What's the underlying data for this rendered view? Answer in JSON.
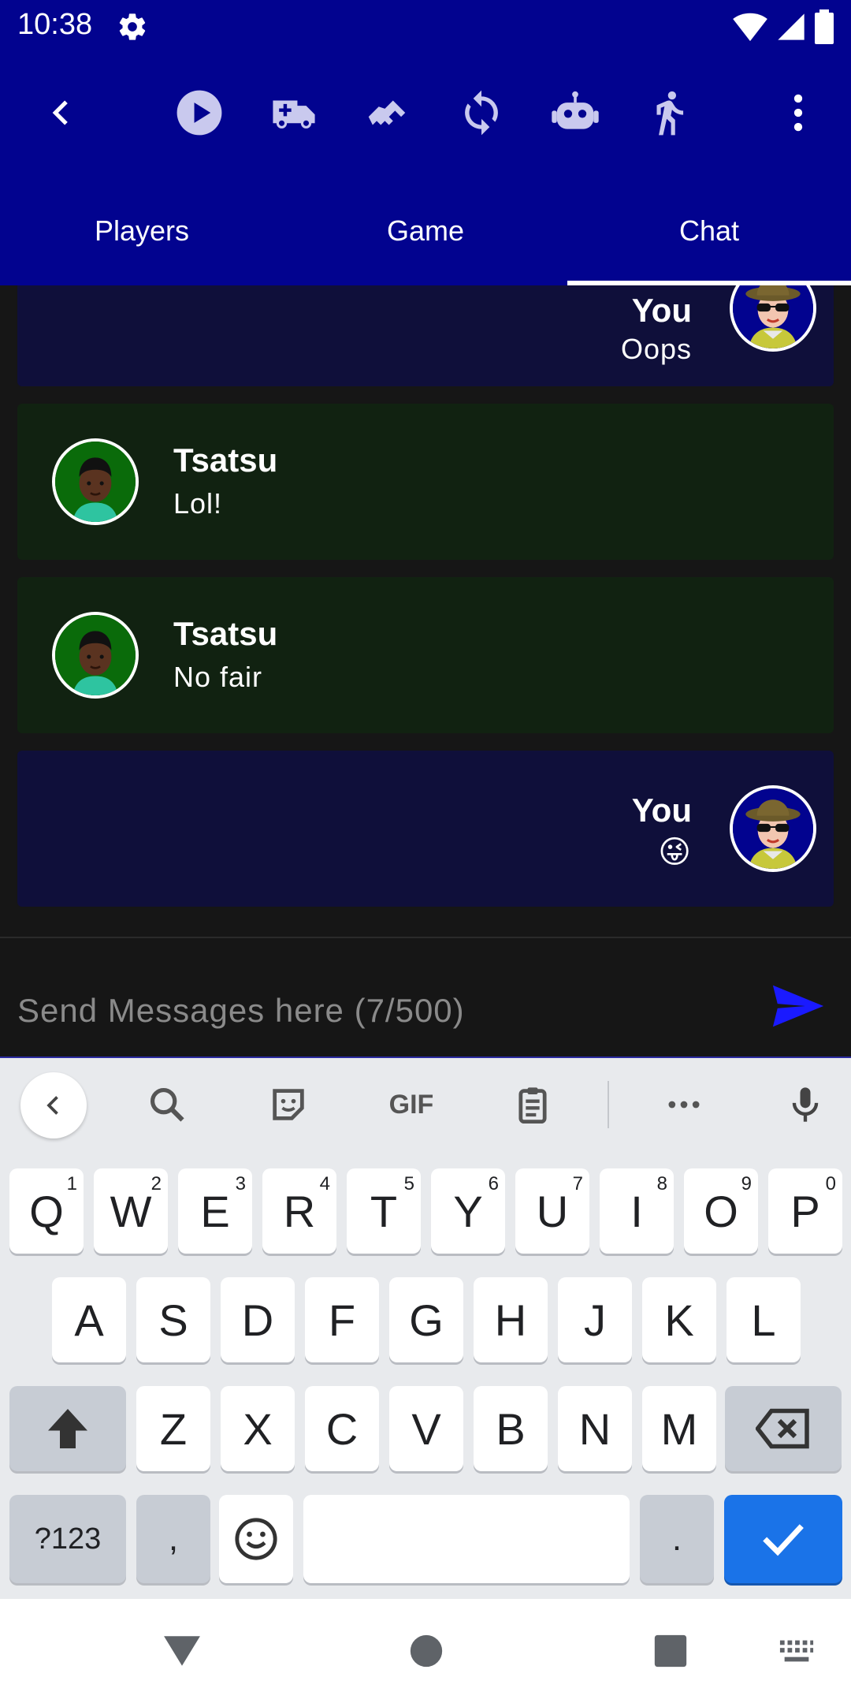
{
  "status_bar": {
    "time": "10:38"
  },
  "tabs": [
    {
      "label": "Players",
      "selected": false
    },
    {
      "label": "Game",
      "selected": false
    },
    {
      "label": "Chat",
      "selected": true
    }
  ],
  "toolbar_icons": [
    "back-arrow-icon",
    "play-icon",
    "ambulance-icon",
    "handshake-icon",
    "sync-icon",
    "robot-icon",
    "walking-person-icon",
    "more-vert-icon"
  ],
  "messages": [
    {
      "sender": "You",
      "text": "Oops",
      "mine": true
    },
    {
      "sender": "Tsatsu",
      "text": "Lol!",
      "mine": false
    },
    {
      "sender": "Tsatsu",
      "text": "No fair",
      "mine": false
    },
    {
      "sender": "You",
      "text": "😜",
      "mine": true
    }
  ],
  "input": {
    "placeholder": "Send Messages here (7/500)"
  },
  "keyboard": {
    "row1": [
      {
        "key": "Q",
        "hint": "1"
      },
      {
        "key": "W",
        "hint": "2"
      },
      {
        "key": "E",
        "hint": "3"
      },
      {
        "key": "R",
        "hint": "4"
      },
      {
        "key": "T",
        "hint": "5"
      },
      {
        "key": "Y",
        "hint": "6"
      },
      {
        "key": "U",
        "hint": "7"
      },
      {
        "key": "I",
        "hint": "8"
      },
      {
        "key": "O",
        "hint": "9"
      },
      {
        "key": "P",
        "hint": "0"
      }
    ],
    "row2": [
      "A",
      "S",
      "D",
      "F",
      "G",
      "H",
      "J",
      "K",
      "L"
    ],
    "row3": [
      "Z",
      "X",
      "C",
      "V",
      "B",
      "N",
      "M"
    ],
    "symbols_label": "?123",
    "comma": ",",
    "period": ".",
    "gif_label": "GIF"
  },
  "colors": {
    "appbar": "#02038f",
    "my_bubble": "#0f0f3a",
    "their_bubble": "#112211",
    "send": "#1a1aff",
    "enter_key": "#1a73e8"
  }
}
